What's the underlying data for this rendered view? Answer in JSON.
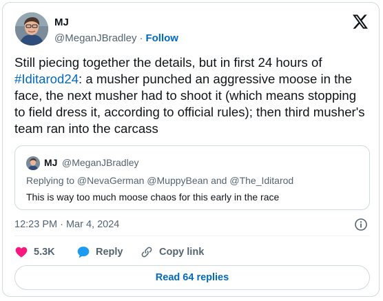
{
  "author": {
    "name": "MJ",
    "handle": "@MeganJBradley",
    "separator": "·",
    "follow_label": "Follow"
  },
  "tweet": {
    "text_before": "Still piecing together the details, but in first 24 hours of ",
    "hashtag": "#Iditarod24",
    "text_after": ": a musher punched an aggressive moose in the face, the next musher had to shoot it (which means stopping to field dress it, according to official rules); then third musher's team ran into the carcass"
  },
  "quoted_tweet": {
    "name": "MJ",
    "handle": "@MeganJBradley",
    "replying_to": "Replying to @NevaGerman @MuppyBean and @The_Iditarod",
    "text": "This is way too much moose chaos for this early in the race"
  },
  "timestamp": "12:23 PM · Mar 4, 2024",
  "actions": {
    "like_count": "5.3K",
    "reply_label": "Reply",
    "copy_link_label": "Copy link"
  },
  "read_replies_label": "Read 64 replies",
  "colors": {
    "link": "#0069c0",
    "heart": "#f91880",
    "reply_bubble": "#1d9bf0",
    "secondary_text": "#536471",
    "border": "#cfd9de"
  },
  "icons": [
    "x-logo-icon",
    "info-icon",
    "heart-icon",
    "reply-bubble-icon",
    "link-icon"
  ]
}
